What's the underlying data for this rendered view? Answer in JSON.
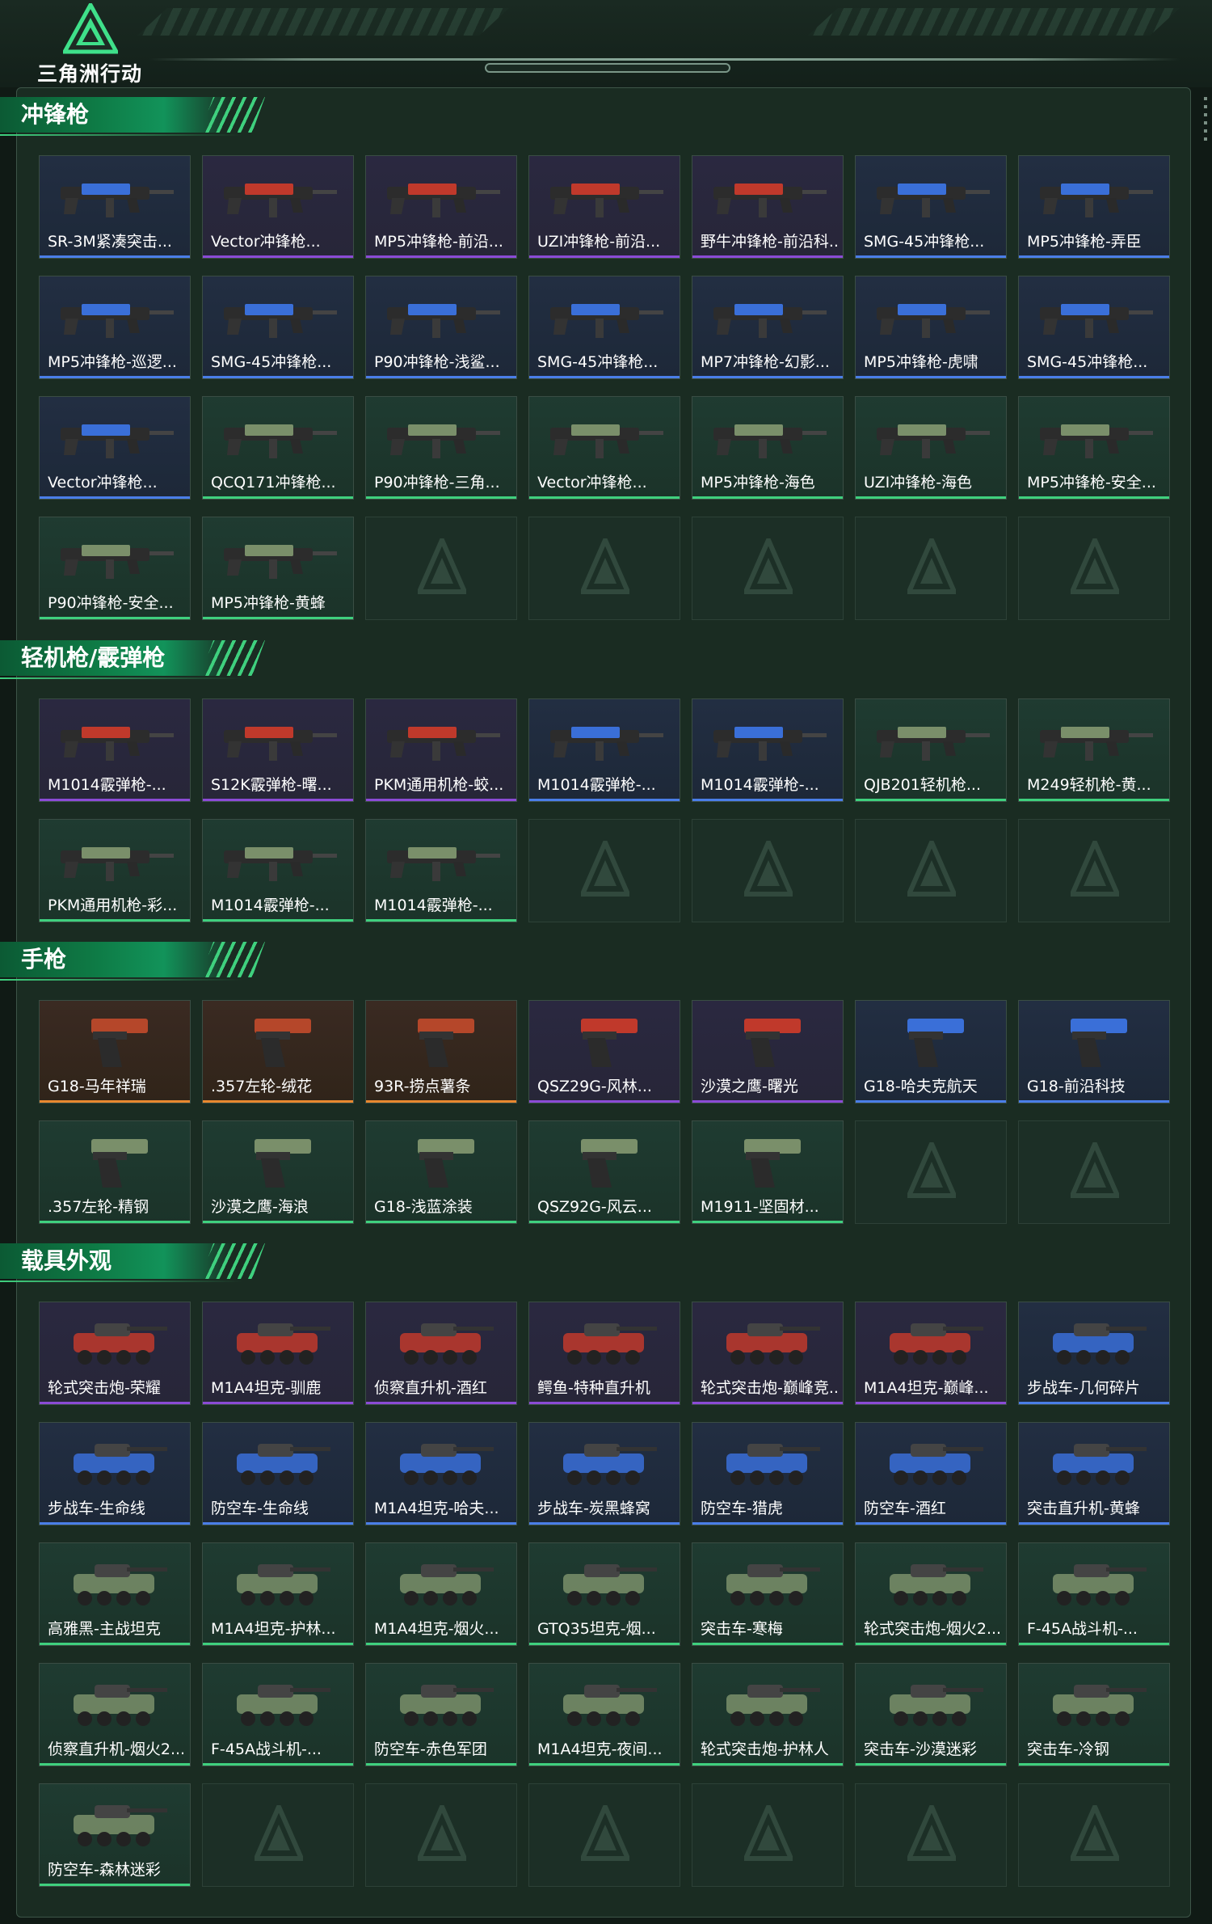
{
  "app": {
    "logo_text": "三角洲行动"
  },
  "colors": {
    "rare_purple": "#8b4bd6",
    "uncommon_green": "#3fd07e",
    "legend_orange": "#e8882f",
    "epic_blue": "#4a7ee8",
    "accent": "#12935a"
  },
  "sections": [
    {
      "title": "冲锋枪",
      "icon": "submachine-gun-icon",
      "items": [
        {
          "label": "SR-3M紧凑突击...",
          "rarity": "blue"
        },
        {
          "label": "Vector冲锋枪...",
          "rarity": "purple"
        },
        {
          "label": "MP5冲锋枪-前沿...",
          "rarity": "purple"
        },
        {
          "label": "UZI冲锋枪-前沿...",
          "rarity": "purple"
        },
        {
          "label": "野牛冲锋枪-前沿科...",
          "rarity": "purple"
        },
        {
          "label": "SMG-45冲锋枪...",
          "rarity": "blue"
        },
        {
          "label": "MP5冲锋枪-弄臣",
          "rarity": "blue"
        },
        {
          "label": "MP5冲锋枪-巡逻...",
          "rarity": "blue"
        },
        {
          "label": "SMG-45冲锋枪...",
          "rarity": "blue"
        },
        {
          "label": "P90冲锋枪-浅鲨...",
          "rarity": "blue"
        },
        {
          "label": "SMG-45冲锋枪...",
          "rarity": "blue"
        },
        {
          "label": "MP7冲锋枪-幻影...",
          "rarity": "blue"
        },
        {
          "label": "MP5冲锋枪-虎啸",
          "rarity": "blue"
        },
        {
          "label": "SMG-45冲锋枪...",
          "rarity": "blue"
        },
        {
          "label": "Vector冲锋枪...",
          "rarity": "blue"
        },
        {
          "label": "QCQ171冲锋枪...",
          "rarity": "green"
        },
        {
          "label": "P90冲锋枪-三角...",
          "rarity": "green"
        },
        {
          "label": "Vector冲锋枪...",
          "rarity": "green"
        },
        {
          "label": "MP5冲锋枪-海色",
          "rarity": "green"
        },
        {
          "label": "UZI冲锋枪-海色",
          "rarity": "green"
        },
        {
          "label": "MP5冲锋枪-安全...",
          "rarity": "green"
        },
        {
          "label": "P90冲锋枪-安全...",
          "rarity": "green"
        },
        {
          "label": "MP5冲锋枪-黄蜂",
          "rarity": "green"
        }
      ],
      "slots": 28
    },
    {
      "title": "轻机枪/霰弹枪",
      "icon": "light-machine-gun-icon",
      "items": [
        {
          "label": "M1014霰弹枪-...",
          "rarity": "purple"
        },
        {
          "label": "S12K霰弹枪-曙...",
          "rarity": "purple"
        },
        {
          "label": "PKM通用机枪-蛟...",
          "rarity": "purple"
        },
        {
          "label": "M1014霰弹枪-...",
          "rarity": "blue"
        },
        {
          "label": "M1014霰弹枪-...",
          "rarity": "blue"
        },
        {
          "label": "QJB201轻机枪...",
          "rarity": "green"
        },
        {
          "label": "M249轻机枪-黄...",
          "rarity": "green"
        },
        {
          "label": "PKM通用机枪-彩...",
          "rarity": "green"
        },
        {
          "label": "M1014霰弹枪-...",
          "rarity": "green"
        },
        {
          "label": "M1014霰弹枪-...",
          "rarity": "green"
        }
      ],
      "slots": 14
    },
    {
      "title": "手枪",
      "icon": "pistol-icon",
      "items": [
        {
          "label": "G18-马年祥瑞",
          "rarity": "orange"
        },
        {
          "label": ".357左轮-绒花",
          "rarity": "orange"
        },
        {
          "label": "93R-捞点薯条",
          "rarity": "orange"
        },
        {
          "label": "QSZ29G-风林...",
          "rarity": "purple"
        },
        {
          "label": "沙漠之鹰-曙光",
          "rarity": "purple"
        },
        {
          "label": "G18-哈夫克航天",
          "rarity": "blue"
        },
        {
          "label": "G18-前沿科技",
          "rarity": "blue"
        },
        {
          "label": ".357左轮-精钢",
          "rarity": "green"
        },
        {
          "label": "沙漠之鹰-海浪",
          "rarity": "green"
        },
        {
          "label": "G18-浅蓝涂装",
          "rarity": "green"
        },
        {
          "label": "QSZ92G-风云...",
          "rarity": "green"
        },
        {
          "label": "M1911-坚固材...",
          "rarity": "green"
        }
      ],
      "slots": 14
    },
    {
      "title": "载具外观",
      "icon": "vehicle-icon",
      "items": [
        {
          "label": "轮式突击炮-荣耀",
          "rarity": "purple"
        },
        {
          "label": "M1A4坦克-驯鹿",
          "rarity": "purple"
        },
        {
          "label": "侦察直升机-酒红",
          "rarity": "purple"
        },
        {
          "label": "鳄鱼-特种直升机",
          "rarity": "purple"
        },
        {
          "label": "轮式突击炮-巅峰竞...",
          "rarity": "purple"
        },
        {
          "label": "M1A4坦克-巅峰...",
          "rarity": "purple"
        },
        {
          "label": "步战车-几何碎片",
          "rarity": "blue"
        },
        {
          "label": "步战车-生命线",
          "rarity": "blue"
        },
        {
          "label": "防空车-生命线",
          "rarity": "blue"
        },
        {
          "label": "M1A4坦克-哈夫...",
          "rarity": "blue"
        },
        {
          "label": "步战车-炭黑蜂窝",
          "rarity": "blue"
        },
        {
          "label": "防空车-猎虎",
          "rarity": "blue"
        },
        {
          "label": "防空车-酒红",
          "rarity": "blue"
        },
        {
          "label": "突击直升机-黄蜂",
          "rarity": "blue"
        },
        {
          "label": "高雅黑-主战坦克",
          "rarity": "green"
        },
        {
          "label": "M1A4坦克-护林...",
          "rarity": "green"
        },
        {
          "label": "M1A4坦克-烟火...",
          "rarity": "green"
        },
        {
          "label": "GTQ35坦克-烟...",
          "rarity": "green"
        },
        {
          "label": "突击车-寒梅",
          "rarity": "green"
        },
        {
          "label": "轮式突击炮-烟火2...",
          "rarity": "green"
        },
        {
          "label": "F-45A战斗机-...",
          "rarity": "green"
        },
        {
          "label": "侦察直升机-烟火2...",
          "rarity": "green"
        },
        {
          "label": "F-45A战斗机-...",
          "rarity": "green"
        },
        {
          "label": "防空车-赤色军团",
          "rarity": "green"
        },
        {
          "label": "M1A4坦克-夜间...",
          "rarity": "green"
        },
        {
          "label": "轮式突击炮-护林人",
          "rarity": "green"
        },
        {
          "label": "突击车-沙漠迷彩",
          "rarity": "green"
        },
        {
          "label": "突击车-冷钢",
          "rarity": "green"
        },
        {
          "label": "防空车-森林迷彩",
          "rarity": "green"
        }
      ],
      "slots": 35
    }
  ]
}
